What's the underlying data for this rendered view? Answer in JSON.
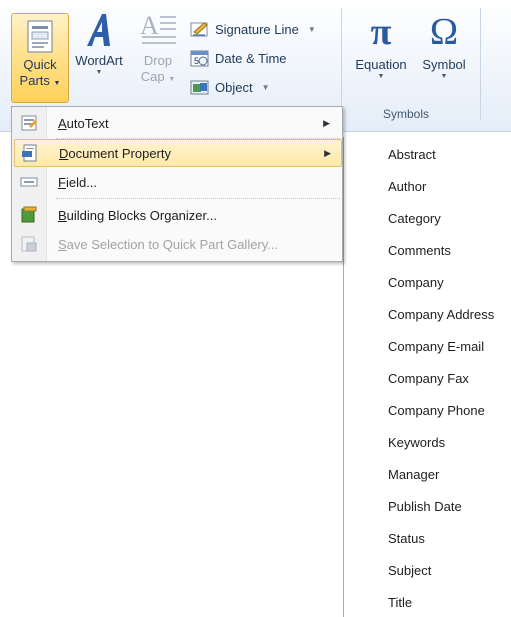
{
  "ribbon": {
    "quick_parts": {
      "line1": "Quick",
      "line2": "Parts"
    },
    "wordart": {
      "label": "WordArt"
    },
    "drop_cap": {
      "line1": "Drop",
      "line2": "Cap"
    },
    "signature_line": {
      "label": "Signature Line"
    },
    "date_time": {
      "label": "Date & Time"
    },
    "object": {
      "label": "Object"
    },
    "equation": {
      "label": "Equation"
    },
    "symbol": {
      "label": "Symbol"
    },
    "symbols_group": {
      "label": "Symbols"
    }
  },
  "menu": {
    "items": [
      {
        "key": "A",
        "rest": "utoText",
        "has_submenu": true,
        "icon": "autotext-icon"
      },
      {
        "key": "D",
        "rest": "ocument Property",
        "has_submenu": true,
        "highlighted": true,
        "icon": "document-property-icon"
      },
      {
        "key": "F",
        "rest": "ield...",
        "icon": "field-icon"
      },
      {
        "key": "B",
        "rest": "uilding Blocks Organizer...",
        "icon": "building-blocks-icon"
      },
      {
        "key": "S",
        "rest": "ave Selection to Quick Part Gallery...",
        "disabled": true,
        "icon": "save-selection-icon"
      }
    ]
  },
  "submenu": {
    "items": [
      "Abstract",
      "Author",
      "Category",
      "Comments",
      "Company",
      "Company Address",
      "Company E-mail",
      "Company Fax",
      "Company Phone",
      "Keywords",
      "Manager",
      "Publish Date",
      "Status",
      "Subject",
      "Title"
    ]
  },
  "colors": {
    "highlight": "#ffe9a8",
    "ribbon_text": "#1e395b",
    "accent_blue": "#2a5a9e"
  }
}
